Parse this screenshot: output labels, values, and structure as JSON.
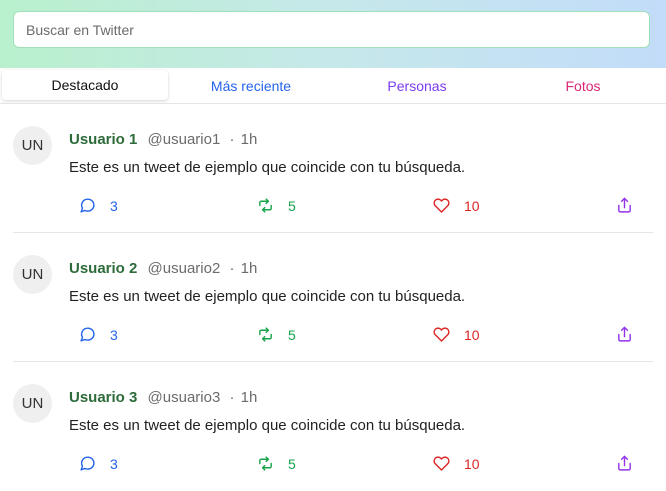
{
  "search": {
    "placeholder": "Buscar en Twitter"
  },
  "tabs": [
    {
      "label": "Destacado",
      "color": "#111111"
    },
    {
      "label": "Más reciente",
      "color": "#2563eb"
    },
    {
      "label": "Personas",
      "color": "#7c3aed"
    },
    {
      "label": "Fotos",
      "color": "#db2777"
    }
  ],
  "tweets": [
    {
      "avatar": "UN",
      "name": "Usuario 1",
      "handle": "@usuario1",
      "dot": "·",
      "time": "1h",
      "text": "Este es un tweet de ejemplo que coincide con tu búsqueda.",
      "replies": "3",
      "retweets": "5",
      "likes": "10"
    },
    {
      "avatar": "UN",
      "name": "Usuario 2",
      "handle": "@usuario2",
      "dot": "·",
      "time": "1h",
      "text": "Este es un tweet de ejemplo que coincide con tu búsqueda.",
      "replies": "3",
      "retweets": "5",
      "likes": "10"
    },
    {
      "avatar": "UN",
      "name": "Usuario 3",
      "handle": "@usuario3",
      "dot": "·",
      "time": "1h",
      "text": "Este es un tweet de ejemplo que coincide con tu búsqueda.",
      "replies": "3",
      "retweets": "5",
      "likes": "10"
    }
  ],
  "icons": {
    "reply": "reply-icon",
    "retweet": "retweet-icon",
    "like": "heart-icon",
    "share": "share-icon"
  },
  "colors": {
    "reply": "#2563eb",
    "retweet": "#16a34a",
    "like": "#dc2626",
    "share": "#9333ea",
    "name": "#2e6b3a"
  }
}
